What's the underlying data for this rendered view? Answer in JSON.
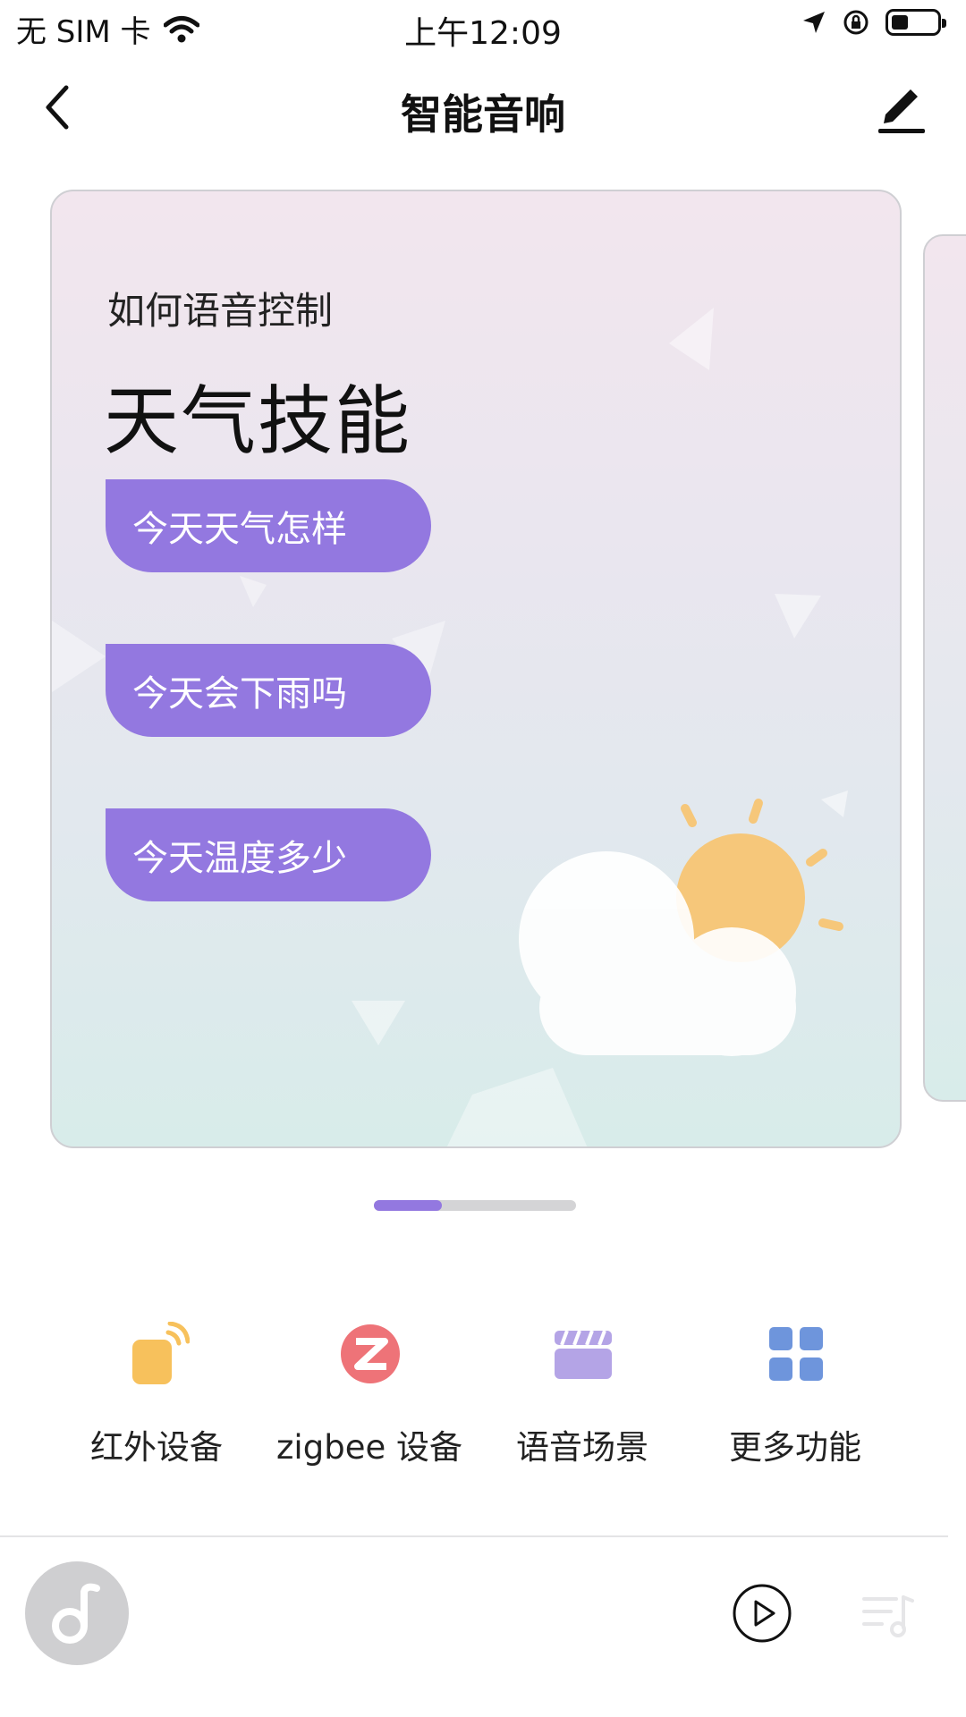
{
  "status_bar": {
    "carrier": "无 SIM 卡",
    "time": "上午12:09"
  },
  "nav": {
    "title": "智能音响"
  },
  "carousel": {
    "active_index": 0,
    "card": {
      "subtitle": "如何语音控制",
      "title": "天气技能",
      "commands": [
        "今天天气怎样",
        "今天会下雨吗",
        "今天温度多少"
      ]
    }
  },
  "features": [
    {
      "label": "红外设备",
      "icon": "infrared-remote-icon"
    },
    {
      "label": "zigbee 设备",
      "icon": "zigbee-icon"
    },
    {
      "label": "语音场景",
      "icon": "clapperboard-icon"
    },
    {
      "label": "更多功能",
      "icon": "grid-icon"
    }
  ],
  "player": {
    "icons": [
      "music-note-icon",
      "play-icon",
      "playlist-icon"
    ]
  },
  "colors": {
    "accent": "#9378e0",
    "sun": "#f6c77a",
    "infrared": "#f7c15c",
    "zigbee": "#ee7378",
    "scene": "#b4a4e6",
    "more": "#6e95dc"
  }
}
